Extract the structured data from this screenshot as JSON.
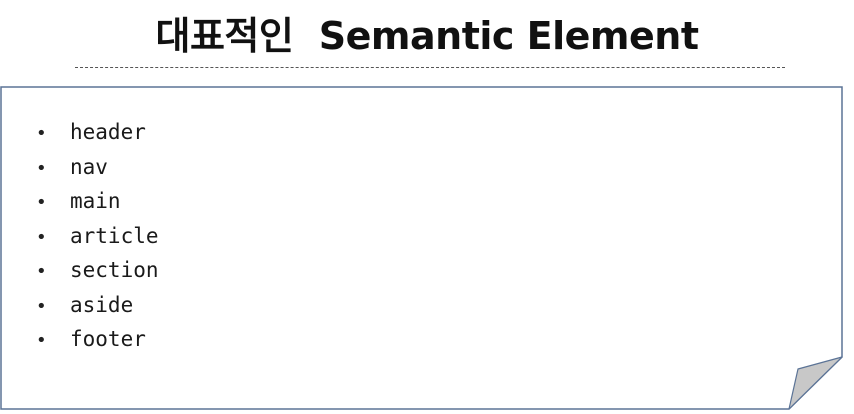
{
  "title": "대표적인  Semantic Element",
  "list": {
    "bullet": "•",
    "items": [
      "header",
      "nav",
      "main",
      "article",
      "section",
      "aside",
      "footer"
    ]
  },
  "colors": {
    "card_border": "#5b7396",
    "page_curl": "#c8c8c8",
    "divider": "#555555",
    "text": "#111111"
  }
}
